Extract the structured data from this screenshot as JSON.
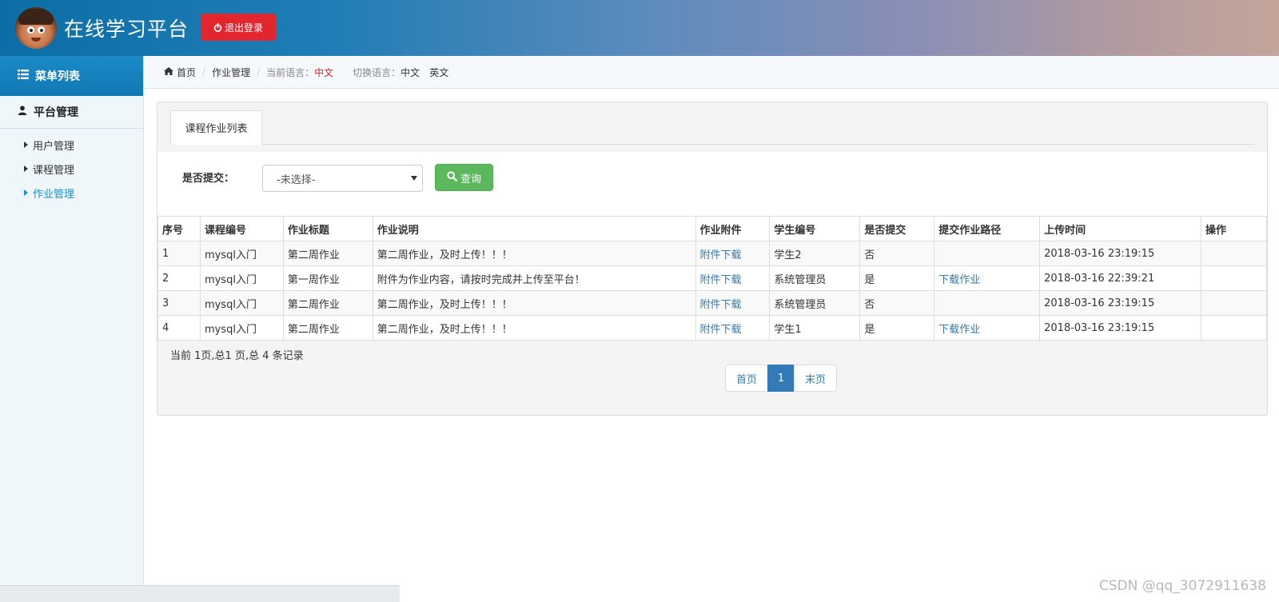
{
  "header": {
    "title": "在线学习平台",
    "logout_label": "退出登录",
    "logout_icon": "power-icon"
  },
  "sidebar": {
    "menu_title": "菜单列表",
    "group_title": "平台管理",
    "items": [
      {
        "label": "用户管理",
        "active": false
      },
      {
        "label": "课程管理",
        "active": false
      },
      {
        "label": "作业管理",
        "active": true
      }
    ]
  },
  "breadcrumb": {
    "home": "首页",
    "current": "作业管理",
    "lang_label": "当前语言：",
    "lang_value": "中文",
    "switch_label": "切换语言：",
    "switch_zh": "中文",
    "switch_en": "英文"
  },
  "panel": {
    "tab_label": "课程作业列表",
    "filter_label": "是否提交：",
    "select_value": "-未选择-",
    "query_label": "查询"
  },
  "table": {
    "columns": [
      "序号",
      "课程编号",
      "作业标题",
      "作业说明",
      "作业附件",
      "学生编号",
      "是否提交",
      "提交作业路径",
      "上传时间",
      "操作"
    ],
    "rows": [
      [
        "1",
        "mysql入门",
        "第二周作业",
        "第二周作业，及时上传！！！",
        "附件下载",
        "学生2",
        "否",
        "",
        "2018-03-16 23:19:15",
        ""
      ],
      [
        "2",
        "mysql入门",
        "第一周作业",
        "附件为作业内容，请按时完成并上传至平台！",
        "附件下载",
        "系统管理员",
        "是",
        "下载作业",
        "2018-03-16 22:39:21",
        ""
      ],
      [
        "3",
        "mysql入门",
        "第二周作业",
        "第二周作业，及时上传！！！",
        "附件下载",
        "系统管理员",
        "否",
        "",
        "2018-03-16 23:19:15",
        ""
      ],
      [
        "4",
        "mysql入门",
        "第二周作业",
        "第二周作业，及时上传！！！",
        "附件下载",
        "学生1",
        "是",
        "下载作业",
        "2018-03-16 23:19:15",
        ""
      ]
    ]
  },
  "pagination": {
    "info": "当前 1页,总1 页,总 4 条记录",
    "first": "首页",
    "current": "1",
    "last": "末页"
  },
  "watermark": "CSDN @qq_3072911638",
  "colors": {
    "accent": "#1079b4",
    "danger": "#e3262d",
    "success": "#5cb85c",
    "link": "#337ab7"
  }
}
